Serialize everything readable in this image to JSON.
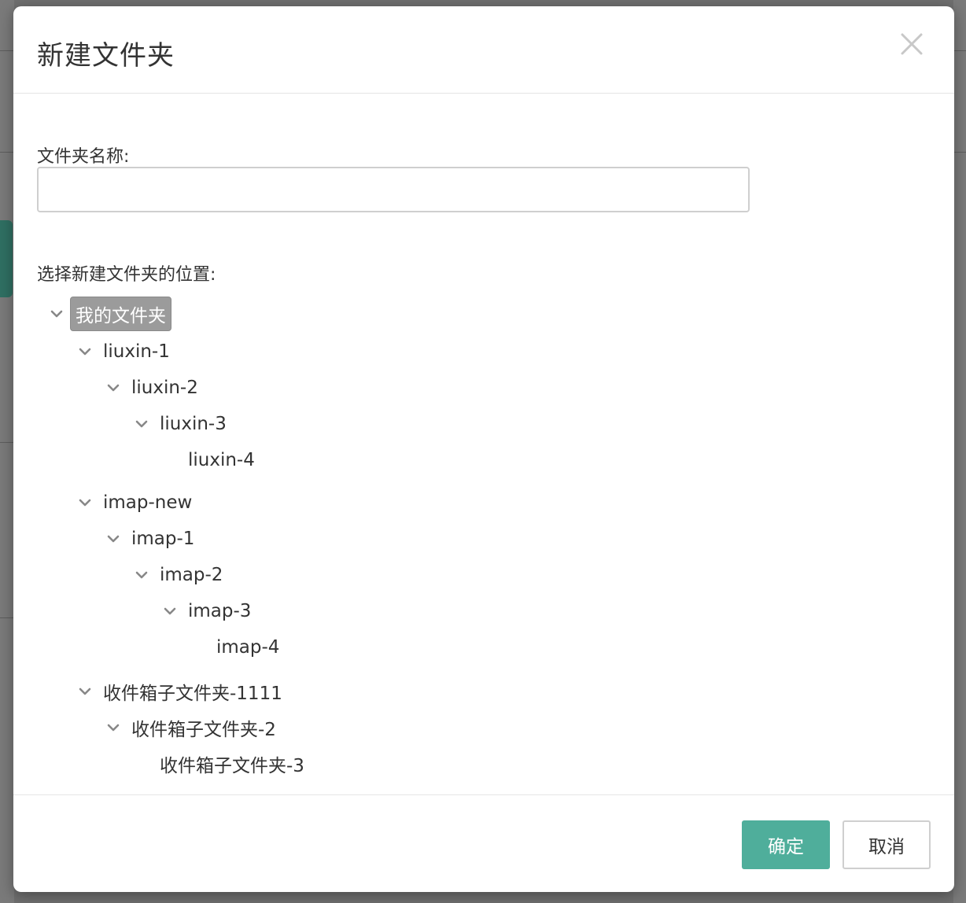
{
  "dialog": {
    "title": "新建文件夹",
    "close_icon": "close-icon"
  },
  "form": {
    "name_label": "文件夹名称:",
    "name_value": "",
    "name_placeholder": "",
    "location_label": "选择新建文件夹的位置:"
  },
  "tree": {
    "nodes": [
      {
        "label": "我的文件夹",
        "level": 0,
        "expanded": true,
        "selected": true
      },
      {
        "label": "liuxin-1",
        "level": 1,
        "expanded": true
      },
      {
        "label": "liuxin-2",
        "level": 2,
        "expanded": true
      },
      {
        "label": "liuxin-3",
        "level": 3,
        "expanded": true
      },
      {
        "label": "liuxin-4",
        "level": 4,
        "leaf": true
      },
      {
        "label": "imap-new",
        "level": 1,
        "expanded": true
      },
      {
        "label": "imap-1",
        "level": 2,
        "expanded": true
      },
      {
        "label": "imap-2",
        "level": 3,
        "expanded": true
      },
      {
        "label": "imap-3",
        "level": 4,
        "expanded": true
      },
      {
        "label": "imap-4",
        "level": 5,
        "leaf": true
      },
      {
        "label": "收件箱子文件夹-1111",
        "level": 1,
        "expanded": true
      },
      {
        "label": "收件箱子文件夹-2",
        "level": 2,
        "expanded": true
      },
      {
        "label": "收件箱子文件夹-3",
        "level": 3,
        "leaf": true
      }
    ]
  },
  "footer": {
    "ok_label": "确定",
    "cancel_label": "取消"
  },
  "colors": {
    "primary_button": "#4fae9b",
    "selected_node": "#9b9b9b",
    "overlay": "#6f6f6f"
  }
}
